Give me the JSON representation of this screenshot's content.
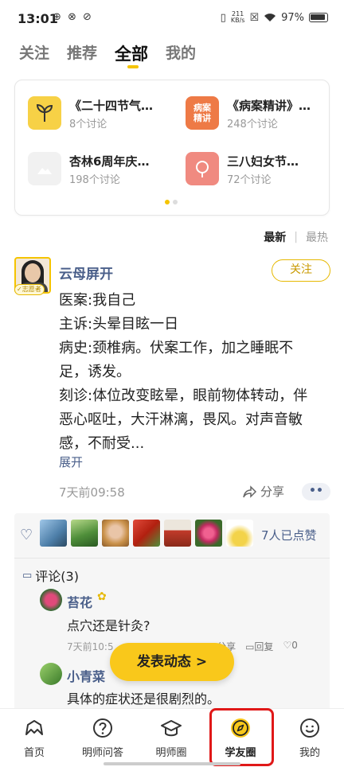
{
  "status_bar": {
    "time": "13:01",
    "app_icons": "⊕ ⊗ ⊘",
    "net_speed_value": "211",
    "net_speed_unit": "KB/s",
    "battery": "97%"
  },
  "tabs": [
    {
      "label": "关注"
    },
    {
      "label": "推荐"
    },
    {
      "label": "全部"
    },
    {
      "label": "我的"
    }
  ],
  "topics": [
    {
      "title": "《二十四节气…",
      "count": "8个讨论"
    },
    {
      "title": "《病案精讲》…",
      "count": "248个讨论",
      "icon_text": "病案精讲"
    },
    {
      "title": "杏林6周年庆…",
      "count": "198个讨论"
    },
    {
      "title": "三八妇女节…",
      "count": "72个讨论"
    }
  ],
  "sort": {
    "latest": "最新",
    "divider": "|",
    "hot": "最热"
  },
  "post": {
    "author": "云母屏开",
    "badge": "志愿者",
    "follow_label": "关注",
    "lines": [
      "医案:我自己",
      "主诉:头晕目眩一日",
      "病史:颈椎病。伏案工作，加之睡眠不",
      "足，诱发。",
      "刻诊:体位改变眩晕，眼前物体转动，伴",
      "恶心呕吐，大汗淋漓，畏风。对声音敏",
      "感，不耐受..."
    ],
    "expand_label": "展开",
    "time": "7天前09:58",
    "share_label": "分享",
    "more_label": "••"
  },
  "likes": {
    "count_label": "7人已点赞"
  },
  "comments": {
    "header": "评论(3)",
    "items": [
      {
        "name": "苔花",
        "text": "点穴还是针灸?",
        "time": "7天前10:5",
        "share": "分享",
        "reply": "回复",
        "likes": "0"
      },
      {
        "name": "小青菜",
        "text": "具体的症状还是很剧烈的。"
      }
    ]
  },
  "fab": {
    "label": "发表动态 >"
  },
  "bottom_nav": [
    {
      "label": "首页",
      "icon": "home-icon"
    },
    {
      "label": "明师问答",
      "icon": "question-icon"
    },
    {
      "label": "明师圈",
      "icon": "graduation-cap-icon"
    },
    {
      "label": "学友圈",
      "icon": "compass-icon"
    },
    {
      "label": "我的",
      "icon": "smile-icon"
    }
  ],
  "colors": {
    "accent": "#f9c81b",
    "link": "#4a5f8a",
    "highlight": "#e01818"
  }
}
